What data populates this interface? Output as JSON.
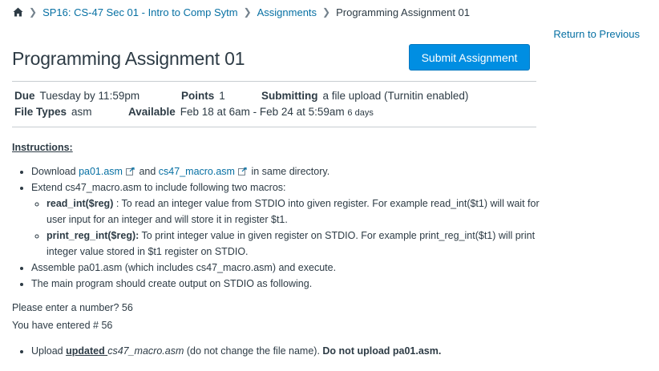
{
  "breadcrumb": {
    "course": "SP16: CS-47 Sec 01 - Intro to Comp Sytm",
    "section": "Assignments",
    "current": "Programming Assignment 01"
  },
  "return_link": "Return to Previous",
  "title": "Programming Assignment 01",
  "submit_label": "Submit Assignment",
  "details": {
    "due_label": "Due",
    "due_value": "Tuesday by 11:59pm",
    "points_label": "Points",
    "points_value": "1",
    "submitting_label": "Submitting",
    "submitting_value": "a file upload (Turnitin enabled)",
    "filetypes_label": "File Types",
    "filetypes_value": "asm",
    "available_label": "Available",
    "available_value": "Feb 18 at 6am - Feb 24 at 5:59am",
    "available_days": "6 days"
  },
  "instructions": {
    "heading": "Instructions:",
    "b1_pre": "Download ",
    "b1_link1": "pa01.asm",
    "b1_mid": " and ",
    "b1_link2": "cs47_macro.asm",
    "b1_post": " in same directory.",
    "b2": "Extend cs47_macro.asm to include following two macros:",
    "s1_name": "read_int($reg)",
    "s1_text": " : To read an integer value from STDIO into given register. For example read_int($t1) will wait for user input for an integer and will store it in register $t1.",
    "s2_name": "print_reg_int($reg):",
    "s2_text": "  To print integer value in given register on STDIO. For example print_reg_int($t1) will print integer value stored in $t1 register on STDIO.",
    "b3": "Assemble pa01.asm (which includes cs47_macro.asm) and execute.",
    "b4": "The main program should create output on STDIO as following.",
    "out1": "Please enter a number? 56",
    "out2": "You have entered # 56",
    "b5_pre": "Upload ",
    "b5_u": "updated ",
    "b5_file": "cs47_macro.asm",
    "b5_mid": " (do not change the file name). ",
    "b5_bold": "Do not upload pa01.asm."
  },
  "icons": {
    "home": "home-icon",
    "external": "external-link-icon"
  }
}
